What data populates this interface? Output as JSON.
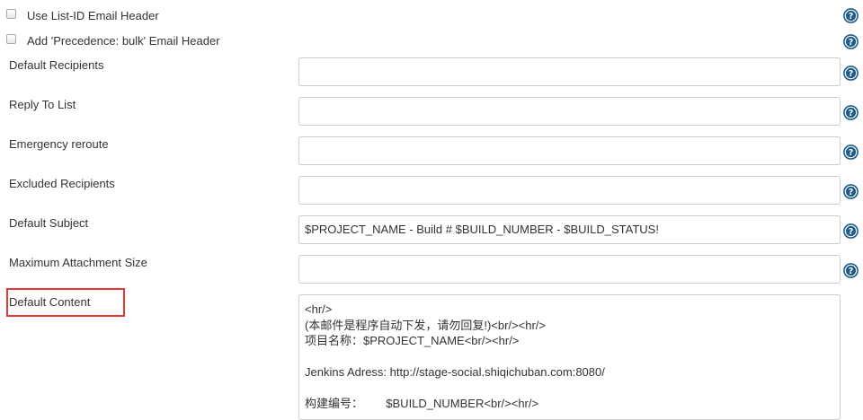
{
  "checkboxes": [
    {
      "label": "Use List-ID Email Header",
      "checked": false
    },
    {
      "label": "Add 'Precedence: bulk' Email Header",
      "checked": false
    }
  ],
  "fields": {
    "default_recipients": {
      "label": "Default Recipients",
      "value": ""
    },
    "reply_to_list": {
      "label": "Reply To List",
      "value": ""
    },
    "emergency_reroute": {
      "label": "Emergency reroute",
      "value": ""
    },
    "excluded_recipients": {
      "label": "Excluded Recipients",
      "value": ""
    },
    "default_subject": {
      "label": "Default Subject",
      "value": "$PROJECT_NAME - Build # $BUILD_NUMBER - $BUILD_STATUS!"
    },
    "max_attachment_size": {
      "label": "Maximum Attachment Size",
      "value": ""
    }
  },
  "default_content": {
    "label": "Default Content",
    "lines": [
      "<hr/>",
      "(本邮件是程序自动下发，请勿回复!)<br/><hr/>",
      "项目名称：$PROJECT_NAME<br/><hr/>",
      "",
      "Jenkins Adress: http://stage-social.shiqichuban.com:8080/",
      "",
      "构建编号：       $BUILD_NUMBER<br/><hr/>"
    ]
  },
  "icons": {
    "help": "help-icon"
  },
  "colors": {
    "help_icon": "#1d5d8c",
    "highlight": "#e53935",
    "input_border": "#cccccc"
  }
}
